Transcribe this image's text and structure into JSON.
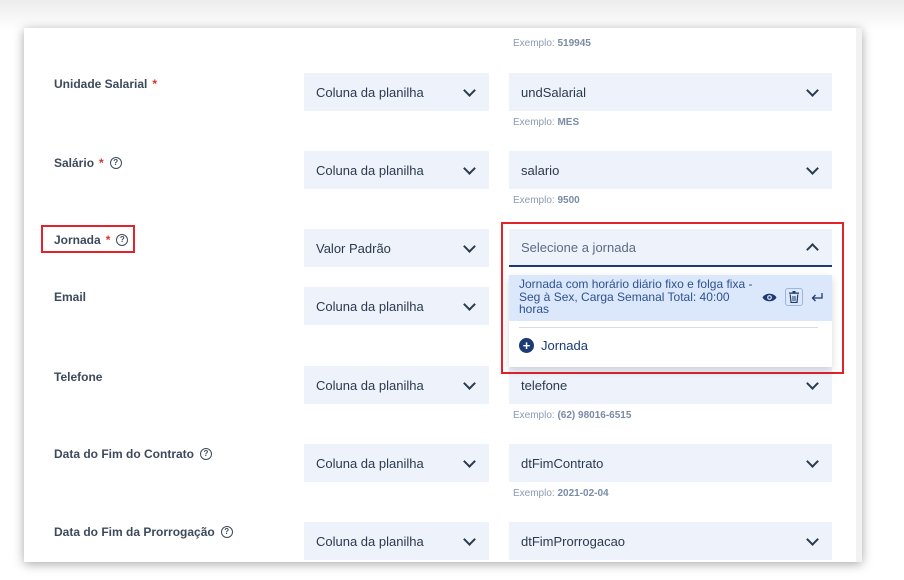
{
  "source_option": "Coluna da planilha",
  "fields": [
    {
      "label": "Unidade Salarial",
      "required": "*",
      "help": "",
      "source": "Coluna da planilha",
      "value": "undSalarial",
      "hint_prefix": "Exemplo:",
      "hint_value": "MES"
    },
    {
      "label": "Salário",
      "required": "*",
      "help": "?",
      "source": "Coluna da planilha",
      "value": "salario",
      "hint_prefix": "Exemplo:",
      "hint_value": "9500"
    },
    {
      "label": "Jornada",
      "required": "*",
      "help": "?",
      "source": "Valor Padrão",
      "value": "Selecione a jornada"
    },
    {
      "label": "Email",
      "required": "",
      "help": "",
      "source": "Coluna da planilha",
      "value": ""
    },
    {
      "label": "Telefone",
      "required": "",
      "help": "",
      "source": "Coluna da planilha",
      "value": "telefone",
      "hint_prefix": "Exemplo:",
      "hint_value": "(62) 98016-6515"
    },
    {
      "label": "Data do Fim do Contrato",
      "required": "",
      "help": "?",
      "source": "Coluna da planilha",
      "value": "dtFimContrato",
      "hint_prefix": "Exemplo:",
      "hint_value": "2021-02-04"
    },
    {
      "label": "Data do Fim da Prorrogação",
      "required": "",
      "help": "?",
      "source": "Coluna da planilha",
      "value": "dtFimProrrogacao"
    }
  ],
  "top_hint": {
    "prefix": "Exemplo:",
    "value": "519945"
  },
  "dropdown": {
    "option_text": "Jornada com horário diário fixo e folga fixa - Seg à Sex, Carga Semanal Total: 40:00 horas",
    "add_label": "Jornada",
    "icons": [
      "eye-icon",
      "trash-icon",
      "enter-icon"
    ]
  },
  "colors": {
    "accent": "#1c3b73",
    "field_bg": "#edf2fb",
    "highlight": "#e1232b",
    "required": "#d9322c",
    "hint": "#8b9bb2"
  }
}
